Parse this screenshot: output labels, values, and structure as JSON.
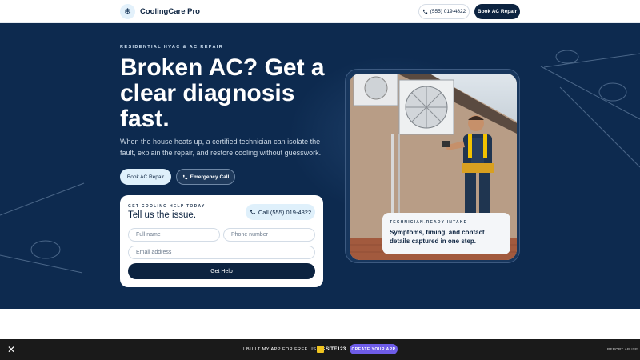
{
  "header": {
    "logo_icon": "snowflake-icon",
    "logo_glyph": "❄",
    "brand": "CoolingCare Pro",
    "phone_label": "(555) 019-4822",
    "book_label": "Book AC Repair"
  },
  "hero": {
    "eyebrow": "RESIDENTIAL HVAC & AC REPAIR",
    "headline": "Broken AC? Get a clear diagnosis fast.",
    "subtext": "When the house heats up, a certified technician can isolate the fault, explain the repair, and restore cooling without guesswork.",
    "book_label": "Book AC Repair",
    "emergency_label": "Emergency Call"
  },
  "form": {
    "eyebrow": "GET COOLING HELP TODAY",
    "title": "Tell us the issue.",
    "call_label": "Call (555) 019-4822",
    "name_placeholder": "Full name",
    "phone_placeholder": "Phone number",
    "email_placeholder": "Email address",
    "submit_label": "Get Help"
  },
  "photo_card": {
    "eyebrow": "TECHNICIAN-READY INTAKE",
    "text": "Symptoms, timing, and contact details captured in one step."
  },
  "bottom_bar": {
    "close_glyph": "✕",
    "built_text": "I BUILT MY APP FOR FREE USING",
    "site_brand": "SITE123",
    "create_label": "CREATE YOUR APP",
    "report_label": "REPORT ABUSE"
  },
  "colors": {
    "navy": "#0d2a4f",
    "button_dark": "#0c2340",
    "pill_light": "#dff0fb",
    "accent_purple": "#6e5ce8"
  }
}
